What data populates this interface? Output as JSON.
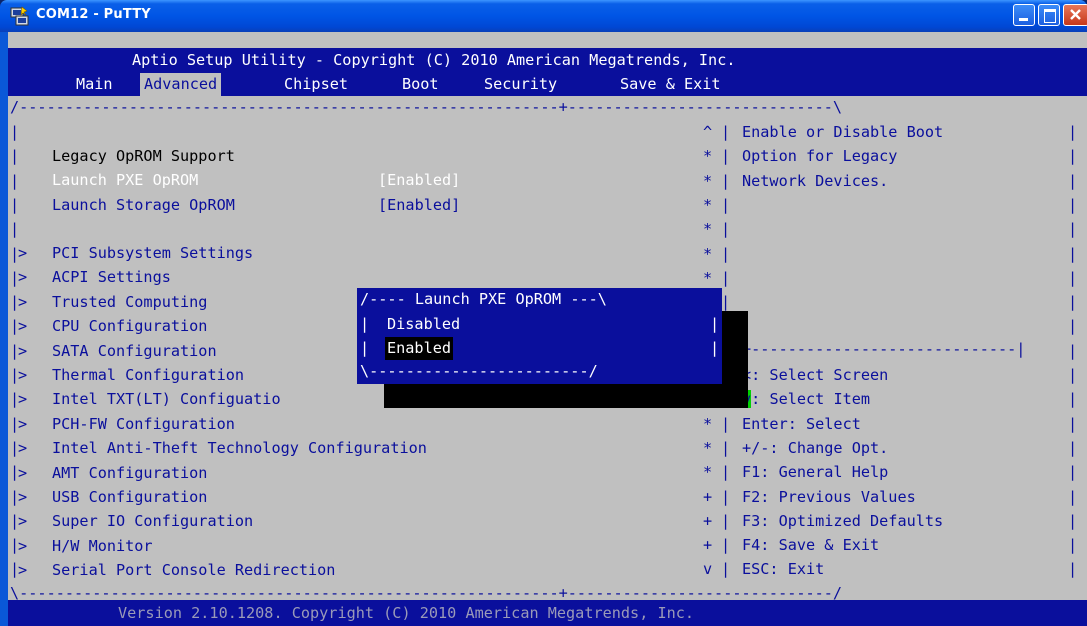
{
  "window": {
    "title": "COM12 - PuTTY",
    "icon": "putty-icon"
  },
  "header": {
    "title": "Aptio Setup Utility - Copyright (C) 2010 American Megatrends, Inc.",
    "tabs": [
      {
        "label": "Main",
        "active": false
      },
      {
        "label": "Advanced",
        "active": true
      },
      {
        "label": "Chipset",
        "active": false
      },
      {
        "label": "Boot",
        "active": false
      },
      {
        "label": "Security",
        "active": false
      },
      {
        "label": "Save & Exit",
        "active": false
      }
    ]
  },
  "settings": {
    "legacy_heading": "Legacy OpROM Support",
    "items": [
      {
        "label": "Launch PXE OpROM",
        "value": "[Enabled]",
        "selected": true
      },
      {
        "label": "Launch Storage OpROM",
        "value": "[Enabled]",
        "selected": false
      }
    ]
  },
  "submenus": [
    "PCI Subsystem Settings",
    "ACPI Settings",
    "Trusted Computing",
    "CPU Configuration",
    "SATA Configuration",
    "Thermal Configuration",
    "Intel TXT(LT) Configuatio",
    "PCH-FW Configuration",
    "Intel Anti-Theft Technology Configuration",
    "AMT Configuration",
    "USB Configuration",
    "Super IO Configuration",
    "H/W Monitor",
    "Serial Port Console Redirection"
  ],
  "help": {
    "lines": [
      "Enable or Disable Boot",
      "Option for Legacy",
      "Network Devices."
    ]
  },
  "keys": {
    "lines": [
      "<: Select Screen",
      "v: Select Item",
      "Enter: Select",
      "+/-: Change Opt.",
      "F1: General Help",
      "F2: Previous Values",
      "F3: Optimized Defaults",
      "F4: Save & Exit",
      "ESC: Exit"
    ]
  },
  "popup": {
    "title": "Launch PXE OpROM",
    "options": [
      "Disabled",
      "Enabled"
    ],
    "selected": "Enabled"
  },
  "scroll_markers": [
    "^",
    "*",
    "*",
    "*",
    "*",
    "*",
    "*",
    "",
    "",
    "",
    "",
    "",
    "*",
    "*",
    "*",
    "+",
    "+",
    "+",
    "v"
  ],
  "footer": "Version 2.10.1208. Copyright (C) 2010 American Megatrends, Inc.",
  "colors": {
    "bios_blue": "#0a0f9c",
    "bios_gray": "#c0c0c0",
    "highlight_green": "#00d000",
    "xp_title_blue": "#0055e5"
  }
}
